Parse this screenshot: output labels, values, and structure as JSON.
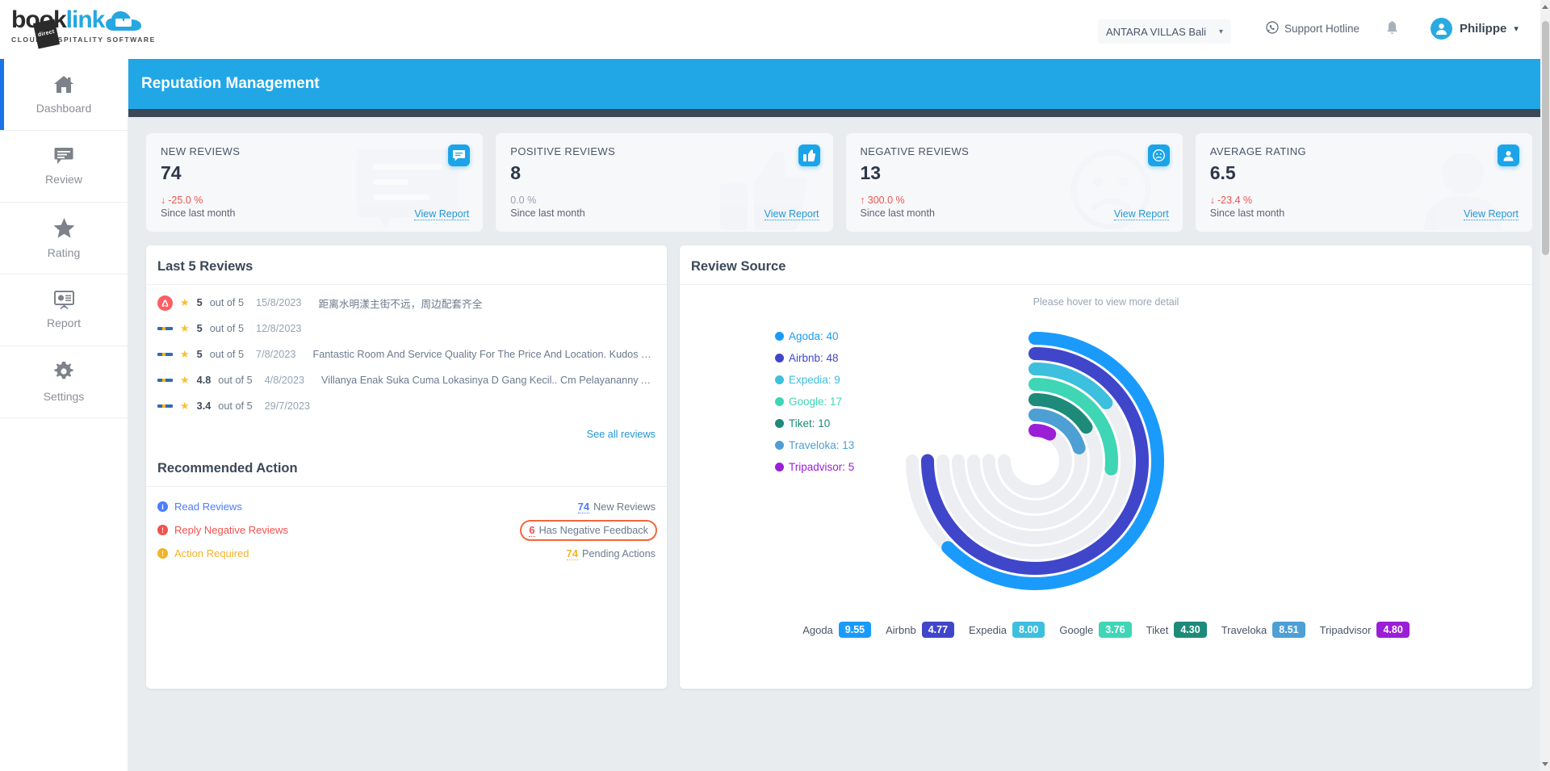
{
  "brand": {
    "logo_book": "book",
    "logo_link": "link",
    "logo_tag": "direct",
    "tagline": "CLOUD HOSPITALITY SOFTWARE"
  },
  "topbar": {
    "property": "ANTARA VILLAS Bali",
    "support_label": "Support Hotline",
    "user_name": "Philippe"
  },
  "sidebar": {
    "items": [
      {
        "label": "Dashboard",
        "icon": "home-icon",
        "active": true
      },
      {
        "label": "Review",
        "icon": "comment-icon",
        "active": false
      },
      {
        "label": "Rating",
        "icon": "star-icon",
        "active": false
      },
      {
        "label": "Report",
        "icon": "presentation-chart-icon",
        "active": false
      },
      {
        "label": "Settings",
        "icon": "gear-icon",
        "active": false
      }
    ]
  },
  "page": {
    "title": "Reputation Management"
  },
  "kpis": [
    {
      "title": "NEW REVIEWS",
      "value": "74",
      "delta": "-25.0 %",
      "direction": "down",
      "arrow": "↓",
      "since": "Since last month",
      "report": "View Report",
      "icon": "comment-icon"
    },
    {
      "title": "POSITIVE REVIEWS",
      "value": "8",
      "delta": "0.0 %",
      "direction": "flat",
      "arrow": "",
      "since": "Since last month",
      "report": "View Report",
      "icon": "thumbs-up-icon"
    },
    {
      "title": "NEGATIVE REVIEWS",
      "value": "13",
      "delta": "300.0 %",
      "direction": "up",
      "arrow": "↑",
      "since": "Since last month",
      "report": "View Report",
      "icon": "sad-face-icon"
    },
    {
      "title": "AVERAGE RATING",
      "value": "6.5",
      "delta": "-23.4 %",
      "direction": "down",
      "arrow": "↓",
      "since": "Since last month",
      "report": "View Report",
      "icon": "user-icon"
    }
  ],
  "reviews_panel": {
    "title": "Last 5 Reviews",
    "see_all": "See all reviews",
    "rows": [
      {
        "source": "airbnb",
        "score": "5",
        "outof": "out of 5",
        "date": "15/8/2023",
        "text": "距离水明漾主街不远，周边配套齐全"
      },
      {
        "source": "booking",
        "score": "5",
        "outof": "out of 5",
        "date": "12/8/2023",
        "text": ""
      },
      {
        "source": "booking",
        "score": "5",
        "outof": "out of 5",
        "date": "7/8/2023",
        "text": "Fantastic Room And Service Quality For The Price And Location. Kudos To Intan..."
      },
      {
        "source": "booking",
        "score": "4.8",
        "outof": "out of 5",
        "date": "4/8/2023",
        "text": "Villanya Enak Suka Cuma Lokasinya D Gang Kecil.. Cm Pelayananny Agak..."
      },
      {
        "source": "booking",
        "score": "3.4",
        "outof": "out of 5",
        "date": "29/7/2023",
        "text": ""
      }
    ]
  },
  "recommended": {
    "title": "Recommended Action",
    "rows": [
      {
        "label": "Read Reviews",
        "color": "#4a7dfc",
        "count": "74",
        "suffix": "New Reviews",
        "count_color": "#4a7dfc",
        "highlight": false
      },
      {
        "label": "Reply Negative Reviews",
        "color": "#f0524d",
        "count": "6",
        "suffix": "Has Negative Feedback",
        "count_color": "#f0524d",
        "highlight": true
      },
      {
        "label": "Action Required",
        "color": "#f0b429",
        "count": "74",
        "suffix": "Pending Actions",
        "count_color": "#f0b429",
        "highlight": false
      }
    ]
  },
  "chart_panel": {
    "title": "Review Source",
    "hint": "Please hover to view more detail"
  },
  "chart_data": {
    "type": "bar",
    "title": "Review Source",
    "categories": [
      "Agoda",
      "Airbnb",
      "Expedia",
      "Google",
      "Tiket",
      "Traveloka",
      "Tripadvisor"
    ],
    "values": [
      40,
      48,
      9,
      17,
      10,
      13,
      5
    ],
    "colors": [
      "#1a9bfc",
      "#4046ca",
      "#3dbfde",
      "#3ed6b5",
      "#1d8a7a",
      "#4d9fd4",
      "#9b1fd6"
    ],
    "legend_position": "left",
    "legend": [
      {
        "label": "Agoda: 40",
        "color": "#1a9bfc"
      },
      {
        "label": "Airbnb: 48",
        "color": "#4046ca"
      },
      {
        "label": "Expedia: 9",
        "color": "#3dbfde"
      },
      {
        "label": "Google: 17",
        "color": "#3ed6b5"
      },
      {
        "label": "Tiket: 10",
        "color": "#1d8a7a"
      },
      {
        "label": "Traveloka: 13",
        "color": "#4d9fd4"
      },
      {
        "label": "Tripadvisor: 5",
        "color": "#9b1fd6"
      }
    ],
    "scores": [
      {
        "name": "Agoda",
        "score": "9.55",
        "color": "#1a9bfc"
      },
      {
        "name": "Airbnb",
        "score": "4.77",
        "color": "#4046ca"
      },
      {
        "name": "Expedia",
        "score": "8.00",
        "color": "#3dbfde"
      },
      {
        "name": "Google",
        "score": "3.76",
        "color": "#3ed6b5"
      },
      {
        "name": "Tiket",
        "score": "4.30",
        "color": "#1d8a7a"
      },
      {
        "name": "Traveloka",
        "score": "8.51",
        "color": "#4d9fd4"
      },
      {
        "name": "Tripadvisor",
        "score": "4.80",
        "color": "#9b1fd6"
      }
    ],
    "ylim": [
      0,
      50
    ]
  }
}
